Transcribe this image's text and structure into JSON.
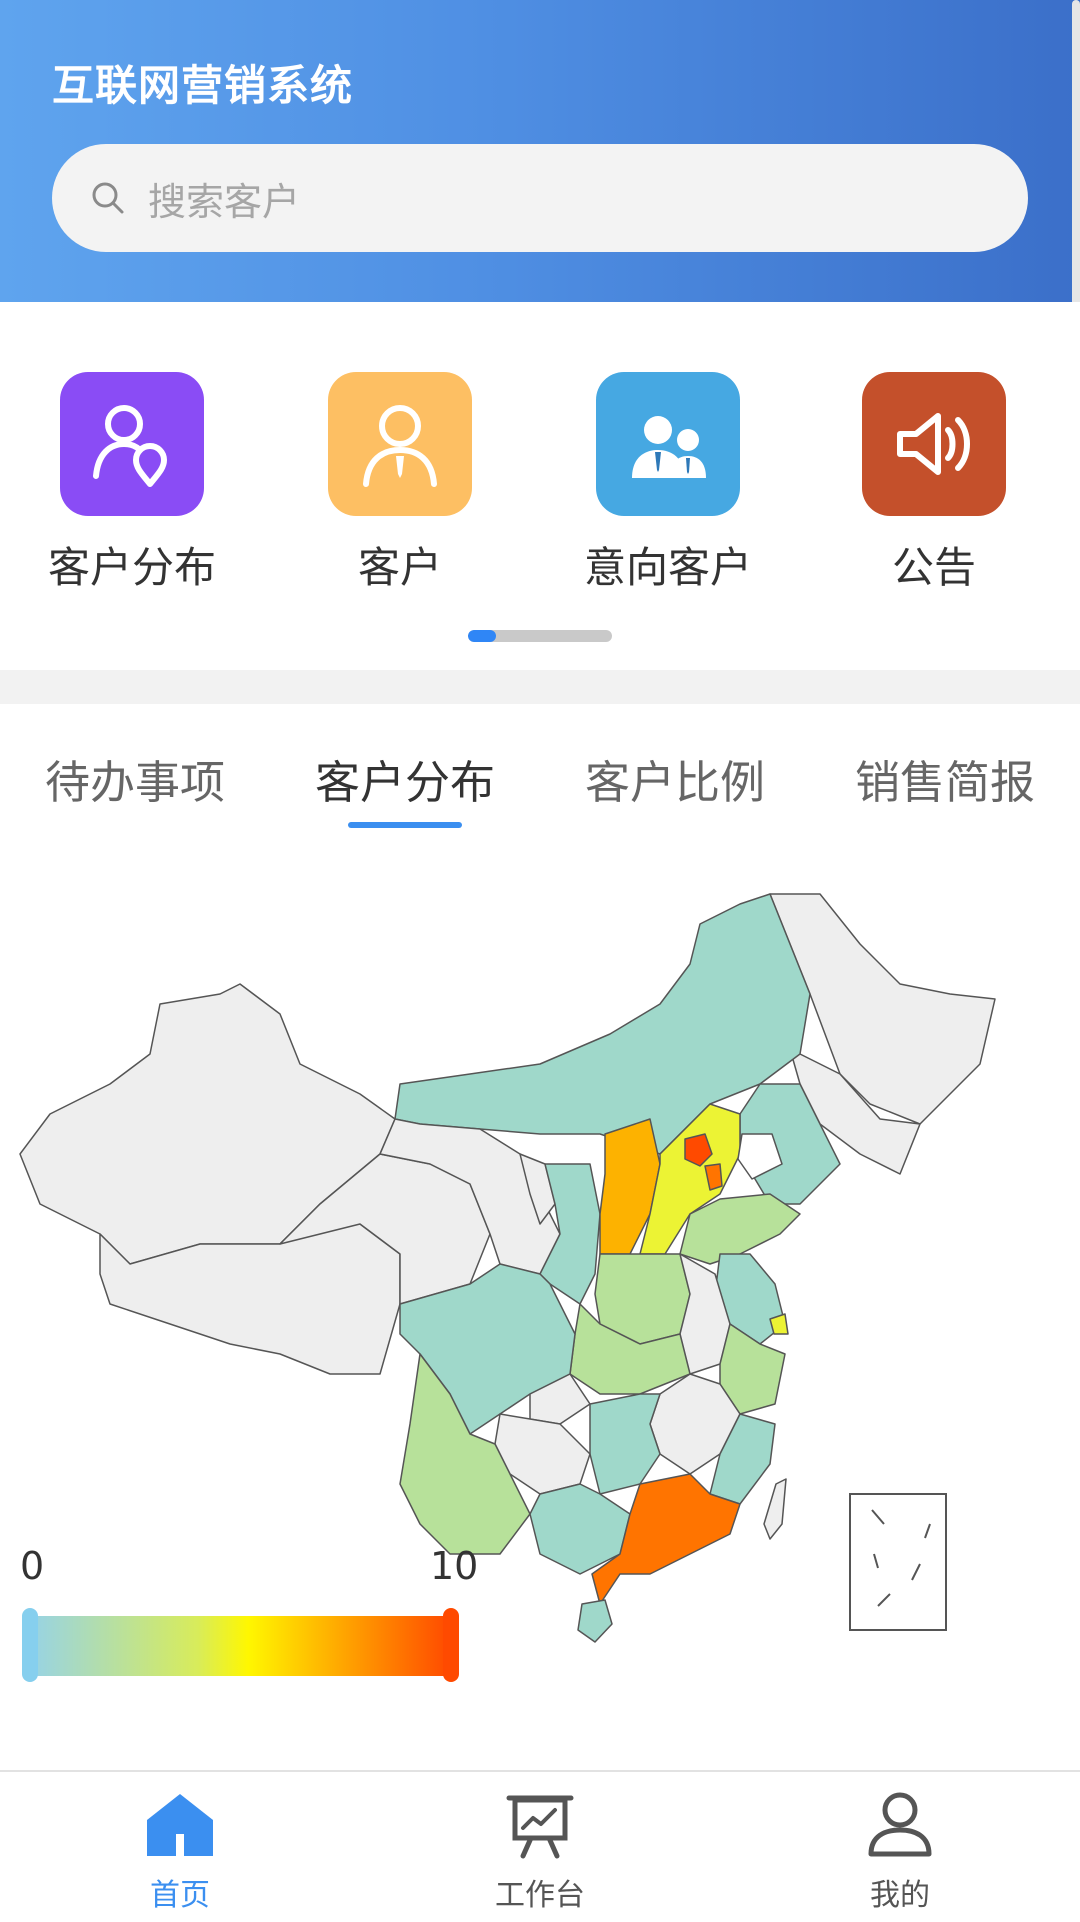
{
  "header": {
    "title": "互联网营销系统",
    "search_placeholder": "搜索客户",
    "background_color": "#4f8fe3"
  },
  "quick_entries": [
    {
      "label": "客户分布",
      "icon": "person-location-icon",
      "color": "#8a4cf5"
    },
    {
      "label": "客户",
      "icon": "person-tie-icon",
      "color": "#fdbf63"
    },
    {
      "label": "意向客户",
      "icon": "people-group-icon",
      "color": "#46a8e2"
    },
    {
      "label": "公告",
      "icon": "speaker-icon",
      "color": "#c4502b"
    }
  ],
  "quick_pager": {
    "current_page": 1
  },
  "tabs": [
    {
      "label": "待办事项",
      "active": false
    },
    {
      "label": "客户分布",
      "active": true
    },
    {
      "label": "客户比例",
      "active": false
    },
    {
      "label": "销售简报",
      "active": false
    }
  ],
  "map": {
    "legend_min": "0",
    "legend_max": "10",
    "range": [
      0,
      10
    ],
    "colors": {
      "none": "#eeeeee",
      "low": "#9fd8ca",
      "low_mid": "#b7e19a",
      "mid": "#ecf334",
      "high": "#fdb200",
      "higher": "#ff7400",
      "max": "#ff4a00"
    }
  },
  "bottom_nav": [
    {
      "label": "首页",
      "icon": "home-icon",
      "active": true
    },
    {
      "label": "工作台",
      "icon": "presentation-board-icon",
      "active": false
    },
    {
      "label": "我的",
      "icon": "user-profile-icon",
      "active": false
    }
  ]
}
